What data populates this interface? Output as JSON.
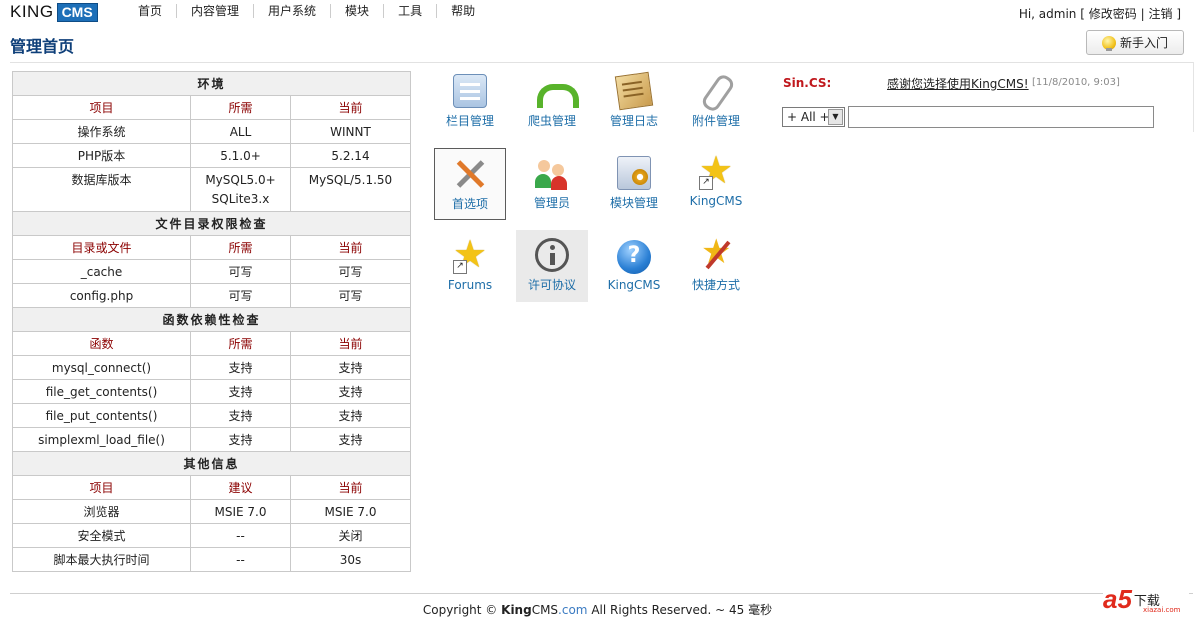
{
  "brand": {
    "king": "KING",
    "cms": "CMS"
  },
  "nav": [
    "首页",
    "内容管理",
    "用户系统",
    "模块",
    "工具",
    "帮助"
  ],
  "user": {
    "greeting": "Hi, admin",
    "open": "[",
    "change_password": "修改密码",
    "sep": "|",
    "logout": "注销",
    "close": "]"
  },
  "page_title": "管理首页",
  "help_button": "新手入门",
  "env": {
    "sections": [
      {
        "title": "环境",
        "header": [
          "项目",
          "所需",
          "当前"
        ],
        "rows": [
          [
            "操作系统",
            "ALL",
            "WINNT"
          ],
          [
            "PHP版本",
            "5.1.0+",
            "5.2.14"
          ],
          [
            "数据库版本",
            "MySQL5.0+ SQLite3.x",
            "MySQL/5.1.50"
          ]
        ]
      },
      {
        "title": "文件目录权限检查",
        "header": [
          "目录或文件",
          "所需",
          "当前"
        ],
        "rows": [
          [
            "_cache",
            "可写",
            "可写"
          ],
          [
            "config.php",
            "可写",
            "可写"
          ]
        ]
      },
      {
        "title": "函数依赖性检查",
        "header": [
          "函数",
          "所需",
          "当前"
        ],
        "rows": [
          [
            "mysql_connect()",
            "支持",
            "支持"
          ],
          [
            "file_get_contents()",
            "支持",
            "支持"
          ],
          [
            "file_put_contents()",
            "支持",
            "支持"
          ],
          [
            "simplexml_load_file()",
            "支持",
            "支持"
          ]
        ]
      },
      {
        "title": "其他信息",
        "header": [
          "项目",
          "建议",
          "当前"
        ],
        "rows": [
          [
            "浏览器",
            "MSIE 7.0",
            "MSIE 7.0"
          ],
          [
            "安全模式",
            "--",
            "关闭"
          ],
          [
            "脚本最大执行时间",
            "--",
            "30s"
          ]
        ]
      }
    ]
  },
  "tiles": [
    {
      "label": "栏目管理",
      "icon": "column-icon"
    },
    {
      "label": "爬虫管理",
      "icon": "spider-icon"
    },
    {
      "label": "管理日志",
      "icon": "log-icon"
    },
    {
      "label": "附件管理",
      "icon": "paperclip-icon"
    },
    {
      "label": "首选项",
      "icon": "tools-icon"
    },
    {
      "label": "管理员",
      "icon": "users-icon"
    },
    {
      "label": "模块管理",
      "icon": "module-icon"
    },
    {
      "label": "KingCMS",
      "icon": "star-shortcut-icon"
    },
    {
      "label": "Forums",
      "icon": "star-shortcut-icon"
    },
    {
      "label": "许可协议",
      "icon": "info-icon"
    },
    {
      "label": "KingCMS",
      "icon": "help-icon"
    },
    {
      "label": "快捷方式",
      "icon": "wand-icon"
    }
  ],
  "panel": {
    "sender": "Sin.CS:",
    "message": "感谢您选择使用KingCMS!",
    "timestamp": "[11/8/2010, 9:03]",
    "select_value": "+ All +",
    "input_value": ""
  },
  "footer": {
    "prefix": "Copyright ©",
    "king": "King",
    "cms": "CMS",
    "dot": ".com",
    "suffix": "All Rights Reserved. ~ 45 毫秒"
  },
  "watermark": {
    "mark": "a5",
    "text": "下载",
    "site": "xiazai.com"
  }
}
